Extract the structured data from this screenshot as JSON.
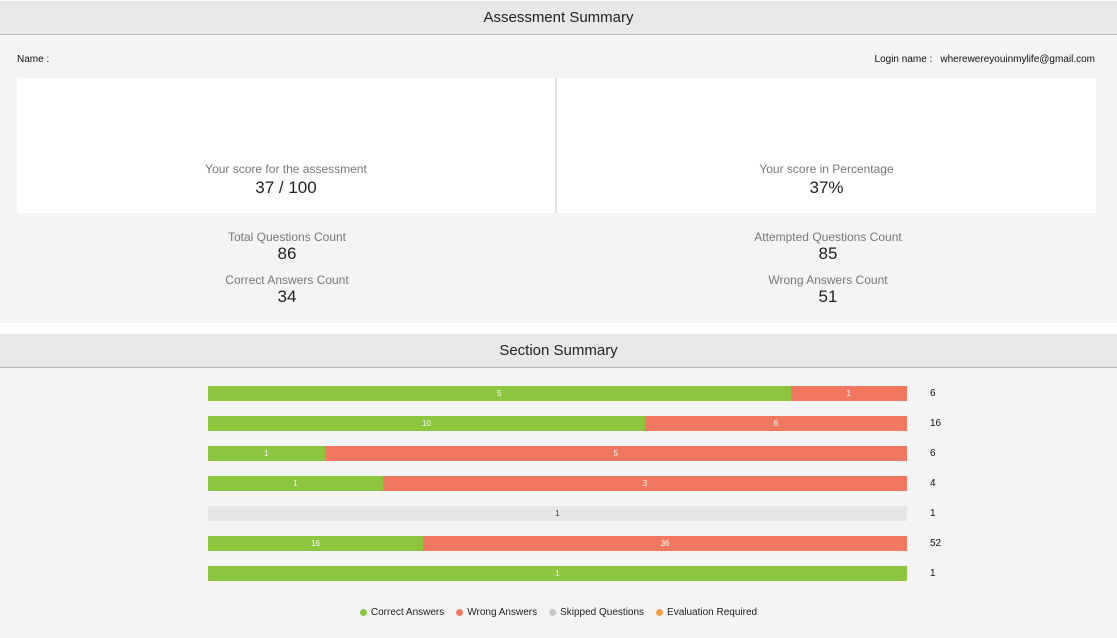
{
  "assessment": {
    "title": "Assessment Summary",
    "name_label": "Name :",
    "login_label": "Login name :",
    "login_value": "wherewereyouinmylife@gmail.com",
    "score_label": "Your score for the assessment",
    "score_value": "37 / 100",
    "percent_label": "Your score in Percentage",
    "percent_value": "37%",
    "total_questions_label": "Total Questions Count",
    "total_questions_value": "86",
    "attempted_label": "Attempted Questions Count",
    "attempted_value": "85",
    "correct_label": "Correct Answers Count",
    "correct_value": "34",
    "wrong_label": "Wrong Answers Count",
    "wrong_value": "51"
  },
  "section": {
    "title": "Section Summary",
    "legend": {
      "correct": "Correct Answers",
      "wrong": "Wrong Answers",
      "skipped": "Skipped Questions",
      "evaluation": "Evaluation Required"
    }
  },
  "colors": {
    "correct": "#8cc63f",
    "wrong": "#f07860",
    "skipped": "#e6e6e6",
    "evaluation": "#f0a040"
  },
  "chart_data": {
    "type": "bar",
    "orientation": "horizontal-stacked",
    "rows": [
      {
        "correct": 5,
        "wrong": 1,
        "skipped": 0,
        "total": 6
      },
      {
        "correct": 10,
        "wrong": 6,
        "skipped": 0,
        "total": 16
      },
      {
        "correct": 1,
        "wrong": 5,
        "skipped": 0,
        "total": 6
      },
      {
        "correct": 1,
        "wrong": 3,
        "skipped": 0,
        "total": 4
      },
      {
        "correct": 0,
        "wrong": 0,
        "skipped": 1,
        "total": 1
      },
      {
        "correct": 16,
        "wrong": 36,
        "skipped": 0,
        "total": 52
      },
      {
        "correct": 1,
        "wrong": 0,
        "skipped": 0,
        "total": 1
      }
    ],
    "series": [
      {
        "name": "Correct Answers"
      },
      {
        "name": "Wrong Answers"
      },
      {
        "name": "Skipped Questions"
      },
      {
        "name": "Evaluation Required"
      }
    ],
    "legend_position": "bottom"
  }
}
